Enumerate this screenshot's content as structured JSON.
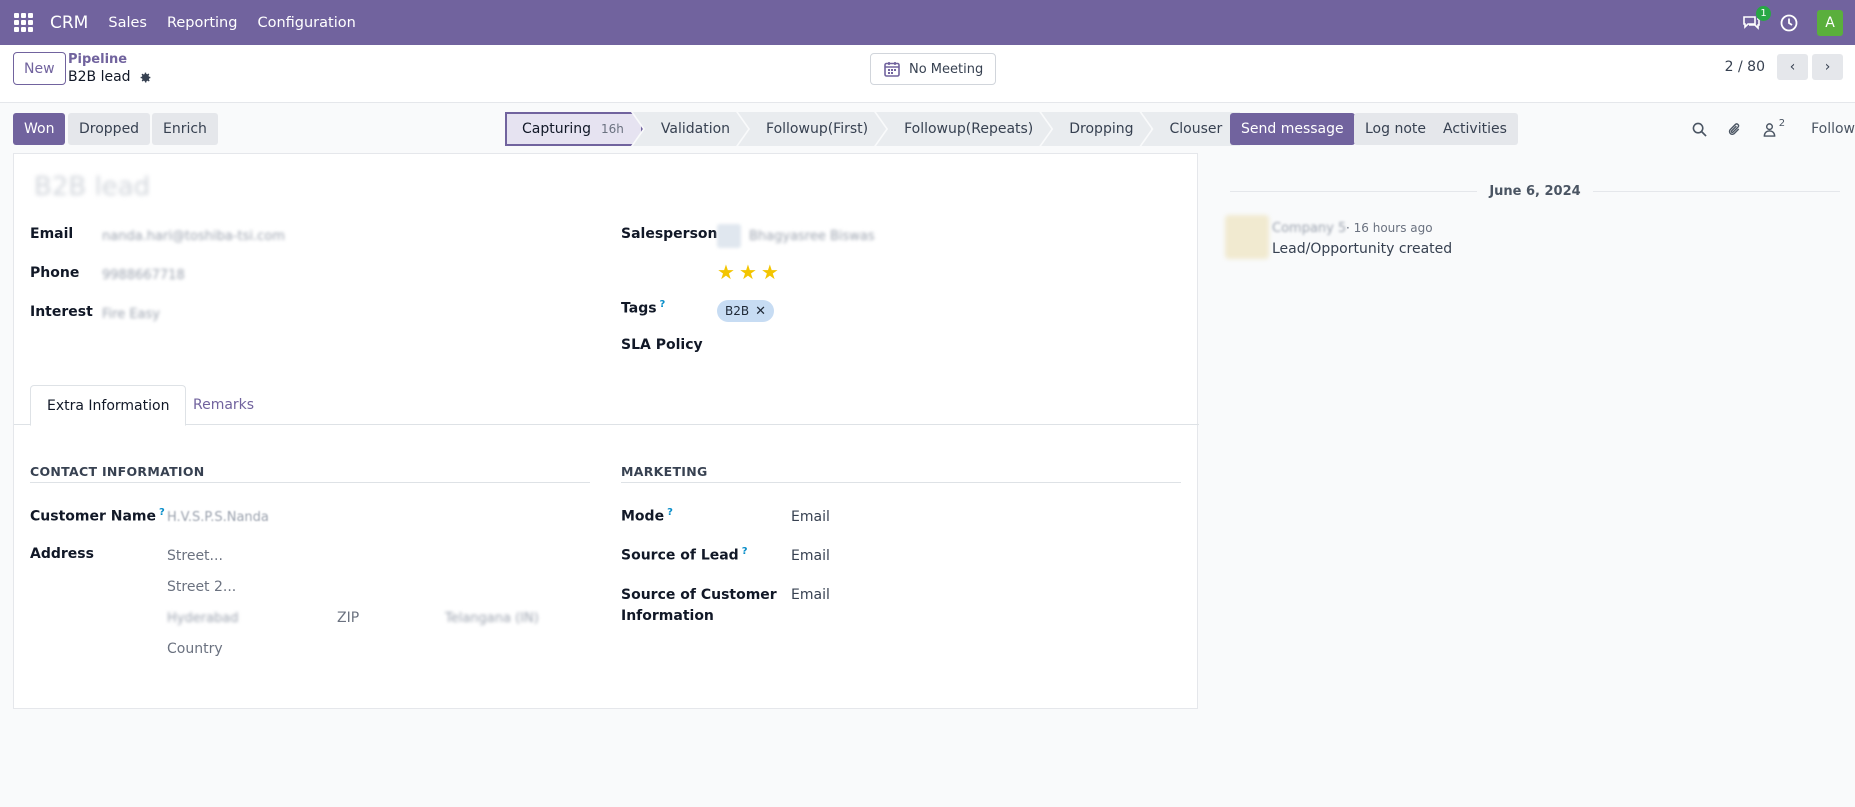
{
  "navbar": {
    "brand": "CRM",
    "menu": [
      "Sales",
      "Reporting",
      "Configuration"
    ],
    "chat_count": "1",
    "avatar_letter": "A"
  },
  "control": {
    "new_label": "New",
    "breadcrumb_parent": "Pipeline",
    "breadcrumb_current": "B2B lead",
    "meeting_label": "No Meeting",
    "pager": "2 / 80"
  },
  "statusbar": {
    "won": "Won",
    "dropped": "Dropped",
    "enrich": "Enrich",
    "stages": [
      {
        "label": "Capturing",
        "time": "16h",
        "active": true
      },
      {
        "label": "Validation"
      },
      {
        "label": "Followup(First)"
      },
      {
        "label": "Followup(Repeats)"
      },
      {
        "label": "Dropping"
      },
      {
        "label": "Clouser"
      }
    ]
  },
  "form": {
    "title": "B2B lead",
    "email_label": "Email",
    "email_value": "nanda.hari@toshiba-tsi.com",
    "phone_label": "Phone",
    "phone_value": "9988667718",
    "interest_label": "Interest",
    "interest_value": "Fire Easy",
    "salesperson_label": "Salesperson",
    "salesperson_value": "Bhagyasree Biswas",
    "priority_stars": 3,
    "tags_label": "Tags",
    "tags": [
      "B2B"
    ],
    "sla_label": "SLA Policy"
  },
  "tabs": [
    "Extra Information",
    "Remarks"
  ],
  "contact": {
    "section_title": "CONTACT INFORMATION",
    "customer_name_label": "Customer Name",
    "customer_name_value": "H.V.S.P.S.Nanda",
    "address_label": "Address",
    "street_placeholder": "Street...",
    "street2_placeholder": "Street 2...",
    "city_value": "Hyderabad",
    "zip_placeholder": "ZIP",
    "state_value": "Telangana (IN)",
    "country_placeholder": "Country"
  },
  "marketing": {
    "section_title": "MARKETING",
    "mode_label": "Mode",
    "mode_value": "Email",
    "source_lead_label": "Source of Lead",
    "source_lead_value": "Email",
    "source_customer_label_1": "Source of Customer",
    "source_customer_label_2": "Information",
    "source_customer_value": "Email"
  },
  "chatter": {
    "send_message": "Send message",
    "log_note": "Log note",
    "activities": "Activities",
    "followers_count": "2",
    "follow": "Follow",
    "date": "June 6, 2024",
    "author": "Company 5",
    "time": "16 hours ago",
    "body": "Lead/Opportunity created"
  },
  "colors": {
    "brand": "#71639e",
    "star": "#f3c500",
    "tag": "#c7dcf3"
  }
}
